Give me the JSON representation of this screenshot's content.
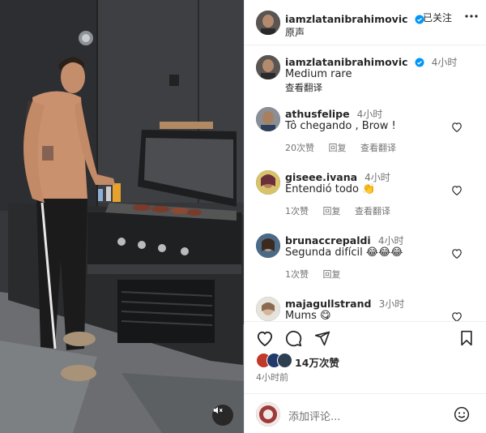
{
  "post": {
    "author": "iamzlatanibrahimovic",
    "follow_label": "已关注",
    "audio_label": "原声",
    "caption_author": "iamzlatanibrahimovic",
    "caption_time": "4小时",
    "caption_text": "Medium rare",
    "caption_translate": "查看翻译"
  },
  "comments": [
    {
      "user": "athusfelipe",
      "time": "4小时",
      "text": "Tô chegando , Brow !",
      "likes": "20次赞",
      "reply": "回复",
      "translate": "查看翻译"
    },
    {
      "user": "giseee.ivana",
      "time": "4小时",
      "text": "Entendió todo 👏",
      "likes": "1次赞",
      "reply": "回复",
      "translate": "查看翻译"
    },
    {
      "user": "brunaccrepaldi",
      "time": "4小时",
      "text": "Segunda difícil 😂😂😂",
      "likes": "1次赞",
      "reply": "回复",
      "translate": ""
    },
    {
      "user": "majagullstrand",
      "time": "3小时",
      "text": "Mums 😋",
      "likes": "",
      "reply": "",
      "translate": ""
    }
  ],
  "actions": {
    "likes_count": "14万次赞",
    "posted_ago": "4小时前",
    "comment_placeholder": "添加评论..."
  },
  "icons": {
    "verified": "verified-badge-icon",
    "more": "more-options-icon",
    "heart": "heart-icon",
    "comment": "comment-icon",
    "share": "share-icon",
    "save": "bookmark-icon",
    "emoji": "emoji-icon",
    "mute": "speaker-muted-icon"
  },
  "colors": {
    "verified_blue": "#0095f6",
    "text_primary": "#262626",
    "text_secondary": "#737373",
    "divider": "#efefef"
  }
}
